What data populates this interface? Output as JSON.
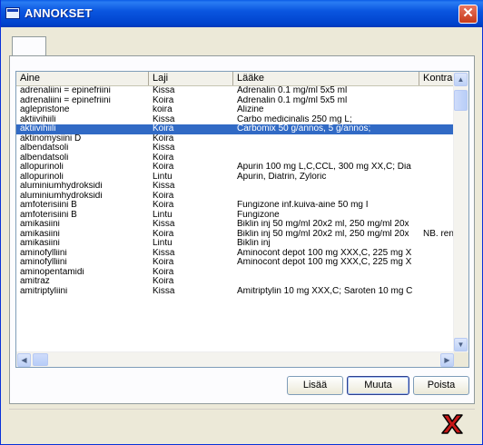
{
  "window": {
    "title": "ANNOKSET",
    "close_glyph": "✕"
  },
  "tab": {
    "label": ""
  },
  "columns": [
    "Aine",
    "Laji",
    "Lääke",
    "Kontra"
  ],
  "rows": [
    {
      "aine": "adrenaliini = epinefriini",
      "laji": "Kissa",
      "laake": "Adrenalin 0.1 mg/ml 5x5 ml",
      "kontra": ""
    },
    {
      "aine": "adrenaliini = epinefriini",
      "laji": "Koira",
      "laake": "Adrenalin 0.1 mg/ml 5x5 ml",
      "kontra": ""
    },
    {
      "aine": "aglepristone",
      "laji": "koira",
      "laake": "Alizine",
      "kontra": ""
    },
    {
      "aine": "aktiivihiili",
      "laji": "Kissa",
      "laake": "Carbo medicinalis 250 mg L;",
      "kontra": ""
    },
    {
      "aine": "aktiivihiili",
      "laji": "Koira",
      "laake": "Carbomix 50 g/annos, 5 g/annos;",
      "kontra": "",
      "selected": true
    },
    {
      "aine": "aktinomysiini D",
      "laji": "Koira",
      "laake": "",
      "kontra": ""
    },
    {
      "aine": "albendatsoli",
      "laji": "Kissa",
      "laake": "",
      "kontra": ""
    },
    {
      "aine": "albendatsoli",
      "laji": "Koira",
      "laake": "",
      "kontra": ""
    },
    {
      "aine": "allopurinoli",
      "laji": "Koira",
      "laake": "Apurin 100 mg L,C,CCL, 300 mg XX,C; Dia",
      "kontra": ""
    },
    {
      "aine": "allopurinoli",
      "laji": "Lintu",
      "laake": "Apurin, Diatrin, Zyloric",
      "kontra": ""
    },
    {
      "aine": "aluminiumhydroksidi",
      "laji": "Kissa",
      "laake": "",
      "kontra": ""
    },
    {
      "aine": "aluminiumhydroksidi",
      "laji": "Koira",
      "laake": "",
      "kontra": ""
    },
    {
      "aine": "amfoterisiini B",
      "laji": "Koira",
      "laake": "Fungizone inf.kuiva-aine 50 mg I",
      "kontra": ""
    },
    {
      "aine": "amfoterisiini B",
      "laji": "Lintu",
      "laake": "Fungizone",
      "kontra": ""
    },
    {
      "aine": "amikasiini",
      "laji": "Kissa",
      "laake": "Biklin inj 50 mg/ml 20x2 ml, 250 mg/ml 20x",
      "kontra": ""
    },
    {
      "aine": "amikasiini",
      "laji": "Koira",
      "laake": "Biklin inj 50 mg/ml 20x2 ml, 250 mg/ml 20x",
      "kontra": "NB. ren"
    },
    {
      "aine": "amikasiini",
      "laji": "Lintu",
      "laake": "Biklin inj",
      "kontra": ""
    },
    {
      "aine": "aminofylliini",
      "laji": "Kissa",
      "laake": "Aminocont depot 100 mg XXX,C, 225 mg X",
      "kontra": ""
    },
    {
      "aine": "aminofylliini",
      "laji": "Koira",
      "laake": "Aminocont depot 100 mg XXX,C, 225 mg X",
      "kontra": ""
    },
    {
      "aine": "aminopentamidi",
      "laji": "Koira",
      "laake": "",
      "kontra": ""
    },
    {
      "aine": "amitraz",
      "laji": "Koira",
      "laake": "",
      "kontra": ""
    },
    {
      "aine": "amitriptyliini",
      "laji": "Kissa",
      "laake": "Amitriptylin 10 mg XXX,C; Saroten 10 mg C",
      "kontra": ""
    }
  ],
  "buttons": {
    "add": "Lisää",
    "edit": "Muuta",
    "delete": "Poista"
  },
  "scroll_glyphs": {
    "up": "▲",
    "down": "▼",
    "left": "◀",
    "right": "▶"
  },
  "icons": {
    "exit": "exit-x-icon"
  }
}
